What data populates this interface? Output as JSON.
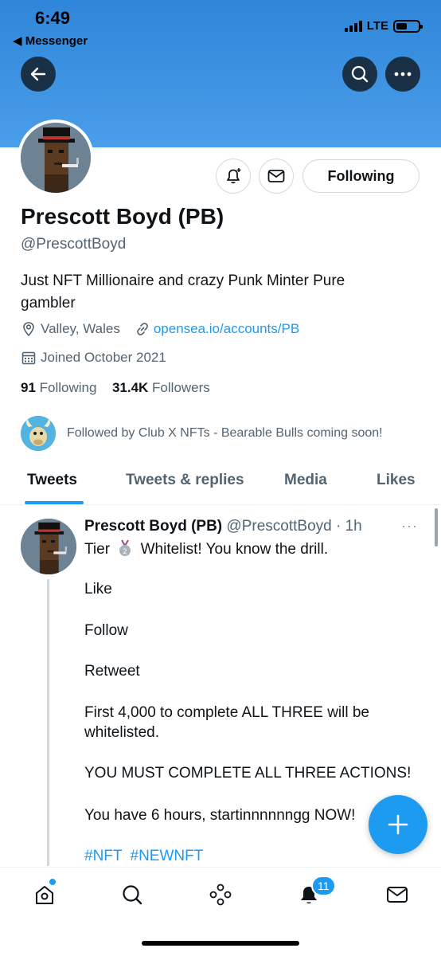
{
  "status_bar": {
    "time": "6:49",
    "back_app": "◀ Messenger",
    "network": "LTE"
  },
  "profile": {
    "name": "Prescott Boyd (PB)",
    "handle": "@PrescottBoyd",
    "bio": "Just NFT Millionaire and crazy Punk Minter Pure gambler",
    "location": "Valley, Wales",
    "link": "opensea.io/accounts/PB",
    "joined": "Joined October 2021",
    "following_count": "91",
    "following_label": "Following",
    "followers_count": "31.4K",
    "followers_label": "Followers",
    "followed_by": "Followed by Club X NFTs - Bearable Bulls coming soon!",
    "follow_button": "Following"
  },
  "tabs": [
    {
      "label": "Tweets",
      "active": true
    },
    {
      "label": "Tweets & replies",
      "active": false
    },
    {
      "label": "Media",
      "active": false
    },
    {
      "label": "Likes",
      "active": false
    }
  ],
  "tweet": {
    "author_name": "Prescott Boyd (PB)",
    "author_handle": "@PrescottBoyd",
    "time": "· 1h",
    "more": "···",
    "line1_before": "Tier",
    "line1_after": "Whitelist! You know the drill.",
    "lines": [
      "Like",
      "Follow",
      "Retweet",
      "First 4,000 to complete ALL THREE will be whitelisted.",
      "YOU MUST COMPLETE ALL THREE ACTIONS!",
      "You have 6 hours, startinnnnnngg NOW!"
    ],
    "hashtags": [
      "#NFT",
      "#NEWNFT"
    ]
  },
  "bottom_nav": {
    "notifications_badge": "11"
  },
  "colors": {
    "accent": "#1d9bf0",
    "banner": "#3b92e0",
    "text": "#0f1419",
    "muted": "#536471"
  },
  "icons": [
    "back-arrow-icon",
    "search-icon",
    "more-icon",
    "bell-plus-icon",
    "mail-icon",
    "location-icon",
    "link-icon",
    "calendar-icon",
    "plus-icon",
    "home-icon",
    "spaces-icon",
    "bell-icon"
  ]
}
